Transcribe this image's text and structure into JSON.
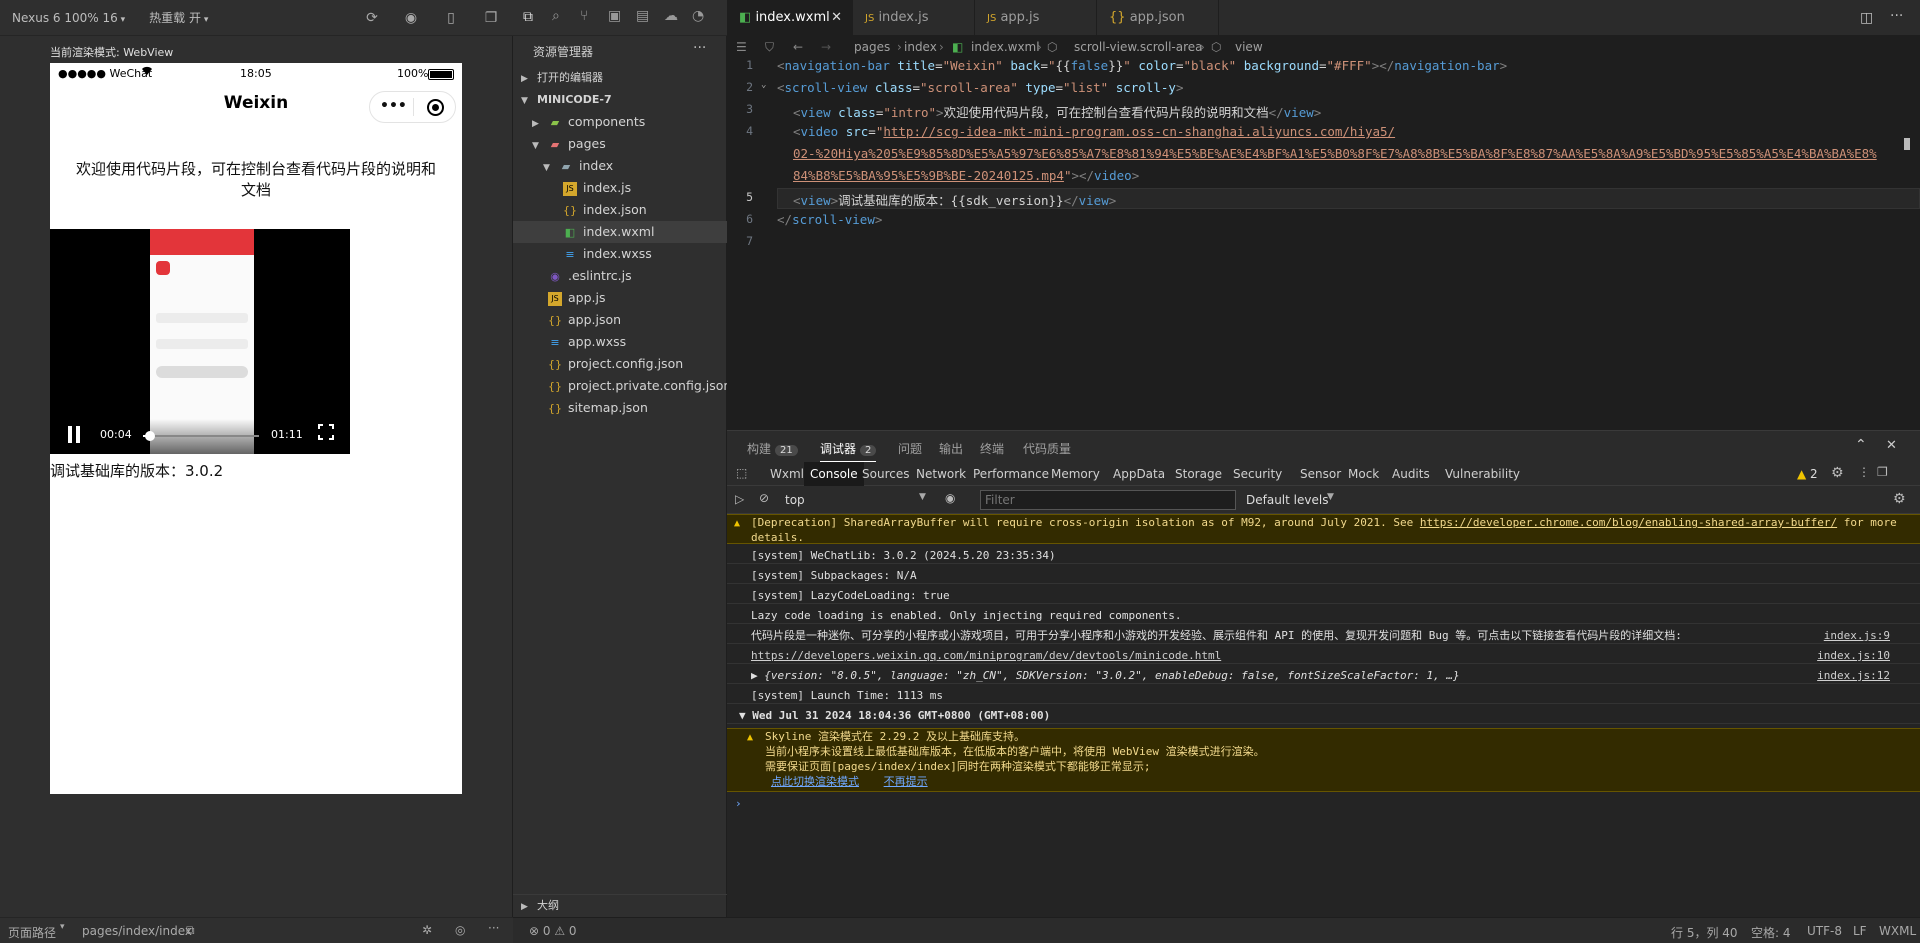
{
  "simulator": {
    "device": "Nexus 6 100% 16",
    "hot_reload": "热重载 开",
    "render_mode": "当前渲染模式: WebView",
    "status_bar": {
      "carrier": "●●●●● WeChat",
      "wifi": "wifi-icon",
      "time": "18:05",
      "battery": "100%"
    },
    "nav_title": "Weixin",
    "intro": "欢迎使用代码片段，可在控制台查看代码片段的说明和文档",
    "video": {
      "current": "00:04",
      "duration": "01:11",
      "progress": 0.06
    },
    "version_text": "调试基础库的版本：3.0.2",
    "footer": {
      "path_label": "页面路径",
      "path": "pages/index/index"
    }
  },
  "explorer": {
    "title": "资源管理器",
    "more": "···",
    "open_editors": "打开的编辑器",
    "project": "MINICODE-7",
    "outline": "大纲",
    "items": [
      {
        "label": "components",
        "type": "folder"
      },
      {
        "label": "pages",
        "type": "folder"
      },
      {
        "label": "index",
        "type": "folder"
      },
      {
        "label": "index.js",
        "type": "js"
      },
      {
        "label": "index.json",
        "type": "json"
      },
      {
        "label": "index.wxml",
        "type": "wxml"
      },
      {
        "label": "index.wxss",
        "type": "wxss"
      },
      {
        "label": ".eslintrc.js",
        "type": "eslint"
      },
      {
        "label": "app.js",
        "type": "js"
      },
      {
        "label": "app.json",
        "type": "json"
      },
      {
        "label": "app.wxss",
        "type": "wxss"
      },
      {
        "label": "project.config.json",
        "type": "json"
      },
      {
        "label": "project.private.config.json",
        "type": "json"
      },
      {
        "label": "sitemap.json",
        "type": "json"
      }
    ]
  },
  "editor": {
    "tabs": [
      "index.wxml",
      "index.js",
      "app.js",
      "app.json"
    ],
    "breadcrumb": [
      "pages",
      "index",
      "index.wxml",
      "scroll-view.scroll-area",
      "view"
    ],
    "line_numbers": [
      "1",
      "2",
      "3",
      "4",
      "",
      "",
      "5",
      "6",
      "7"
    ]
  },
  "panel": {
    "tabs": [
      {
        "label": "构建",
        "count": "21"
      },
      {
        "label": "调试器",
        "count": "2"
      },
      {
        "label": "问题",
        "count": ""
      },
      {
        "label": "输出",
        "count": ""
      },
      {
        "label": "终端",
        "count": ""
      },
      {
        "label": "代码质量",
        "count": ""
      }
    ],
    "devtools_tabs": [
      "Wxml",
      "Console",
      "Sources",
      "Network",
      "Performance",
      "Memory",
      "AppData",
      "Storage",
      "Security",
      "Sensor",
      "Mock",
      "Audits",
      "Vulnerability"
    ],
    "warn_count": "2",
    "context": "top",
    "filter_placeholder": "Filter",
    "levels": "Default levels",
    "console": {
      "deprecation_a": "[Deprecation] SharedArrayBuffer will require cross-origin isolation as of M92, around July 2021. See ",
      "deprecation_link": "https://developer.chrome.com/blog/enabling-shared-array-buffer/",
      "deprecation_b": " for more",
      "deprecation_c": "details.",
      "lib": "[system] WeChatLib: 3.0.2 (2024.5.20 23:35:34)",
      "subpackages": "[system] Subpackages: N/A",
      "lazy": "[system] LazyCodeLoading: true",
      "lazy_msg": "Lazy code loading is enabled. Only injecting required components.",
      "snippet": "代码片段是一种迷你、可分享的小程序或小游戏项目，可用于分享小程序和小游戏的开发经验、展示组件和 API 的使用、复现开发问题和 Bug 等。可点击以下链接查看代码片段的详细文档:",
      "snippet_src": "index.js:9",
      "doc_link": "https://developers.weixin.qq.com/miniprogram/dev/devtools/minicode.html",
      "doc_src": "index.js:10",
      "obj": "▶ {version: \"8.0.5\", language: \"zh_CN\", SDKVersion: \"3.0.2\", enableDebug: false, fontSizeScaleFactor: 1, …}",
      "obj_src": "index.js:12",
      "launch": "[system] Launch Time: 1113 ms",
      "group": "▼ Wed Jul 31 2024 18:04:36 GMT+0800 (GMT+08:00)",
      "skyline_1": "Skyline 渲染模式在 2.29.2 及以上基础库支持。",
      "skyline_2": "当前小程序未设置线上最低基础库版本，在低版本的客户端中，将使用 WebView 渲染模式进行渲染。",
      "skyline_3": "需要保证页面[pages/index/index]同时在两种渲染模式下都能够正常显示;",
      "switch_link": "点此切换渲染模式",
      "dismiss_link": "不再提示",
      "prompt": "›"
    }
  },
  "statusbar": {
    "errors": "⊗ 0 ⚠ 0",
    "position": "行 5，列 40",
    "spaces": "空格: 4",
    "encoding": "UTF-8",
    "eol": "LF",
    "lang": "WXML"
  }
}
